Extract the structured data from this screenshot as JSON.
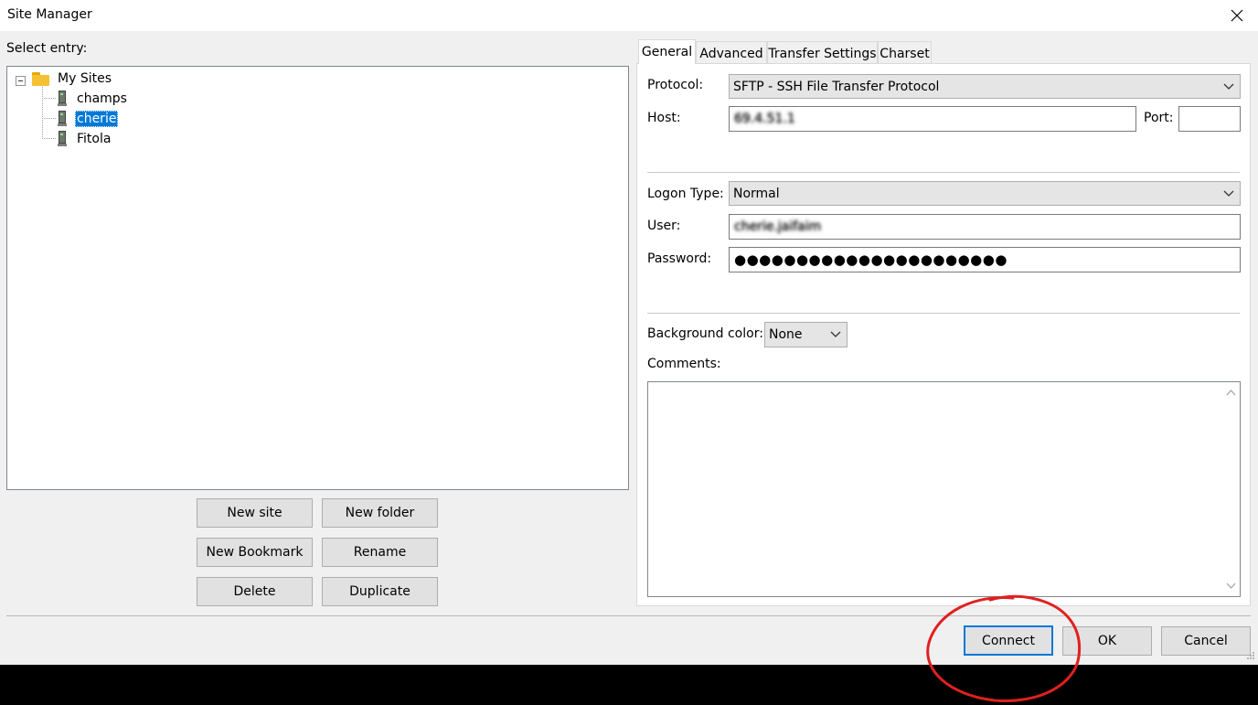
{
  "window": {
    "title": "Site Manager"
  },
  "left": {
    "select_entry_label": "Select entry:",
    "tree": {
      "root": "My Sites",
      "sites": [
        {
          "label": "champs",
          "selected": false
        },
        {
          "label": "cherie",
          "selected": true
        },
        {
          "label": "Fitola",
          "selected": false
        }
      ]
    },
    "buttons": {
      "new_site": "New site",
      "new_folder": "New folder",
      "new_bookmark": "New Bookmark",
      "rename": "Rename",
      "delete": "Delete",
      "duplicate": "Duplicate"
    }
  },
  "tabs": [
    "General",
    "Advanced",
    "Transfer Settings",
    "Charset"
  ],
  "general": {
    "protocol_label": "Protocol:",
    "protocol_value": "SFTP - SSH File Transfer Protocol",
    "host_label": "Host:",
    "host_value": "69.4.51.1",
    "port_label": "Port:",
    "port_value": "",
    "logon_type_label": "Logon Type:",
    "logon_type_value": "Normal",
    "user_label": "User:",
    "user_value": "cherie.jaifaim",
    "password_label": "Password:",
    "password_value": "●●●●●●●●●●●●●●●●●●●●●●",
    "background_color_label": "Background color:",
    "background_color_value": "None",
    "comments_label": "Comments:",
    "comments_value": ""
  },
  "footer": {
    "connect": "Connect",
    "ok": "OK",
    "cancel": "Cancel"
  },
  "colors": {
    "accent": "#0078d7",
    "annotation": "#e02020",
    "selection": "#0078d7"
  },
  "icons": [
    "close-icon",
    "folder-icon",
    "server-icon",
    "chevron-down-icon",
    "scroll-up-icon",
    "scroll-down-icon",
    "resize-grip-icon"
  ]
}
